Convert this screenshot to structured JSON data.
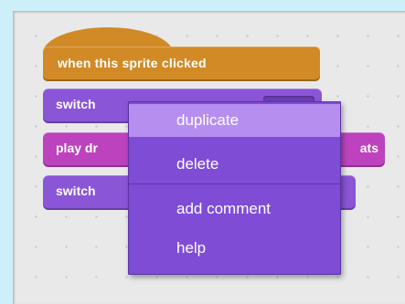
{
  "blocks": {
    "hat_label": "when this sprite clicked",
    "switch1_label": "switch",
    "play_label": "play dr",
    "play_suffix": "ats",
    "switch2_label": "switch"
  },
  "context_menu": {
    "items": [
      {
        "label": "duplicate",
        "highlighted": true
      },
      {
        "label": "delete",
        "highlighted": false
      },
      {
        "label": "add comment",
        "highlighted": false
      },
      {
        "label": "help",
        "highlighted": false
      }
    ]
  },
  "colors": {
    "background_frame": "#cdeff9",
    "scripts_area": "#e9e9e9",
    "events_block": "#d18a26",
    "looks_block": "#8a55d7",
    "sound_block": "#bd42bd",
    "menu_background": "#7f4cd6",
    "menu_highlight": "#b58ef0"
  }
}
